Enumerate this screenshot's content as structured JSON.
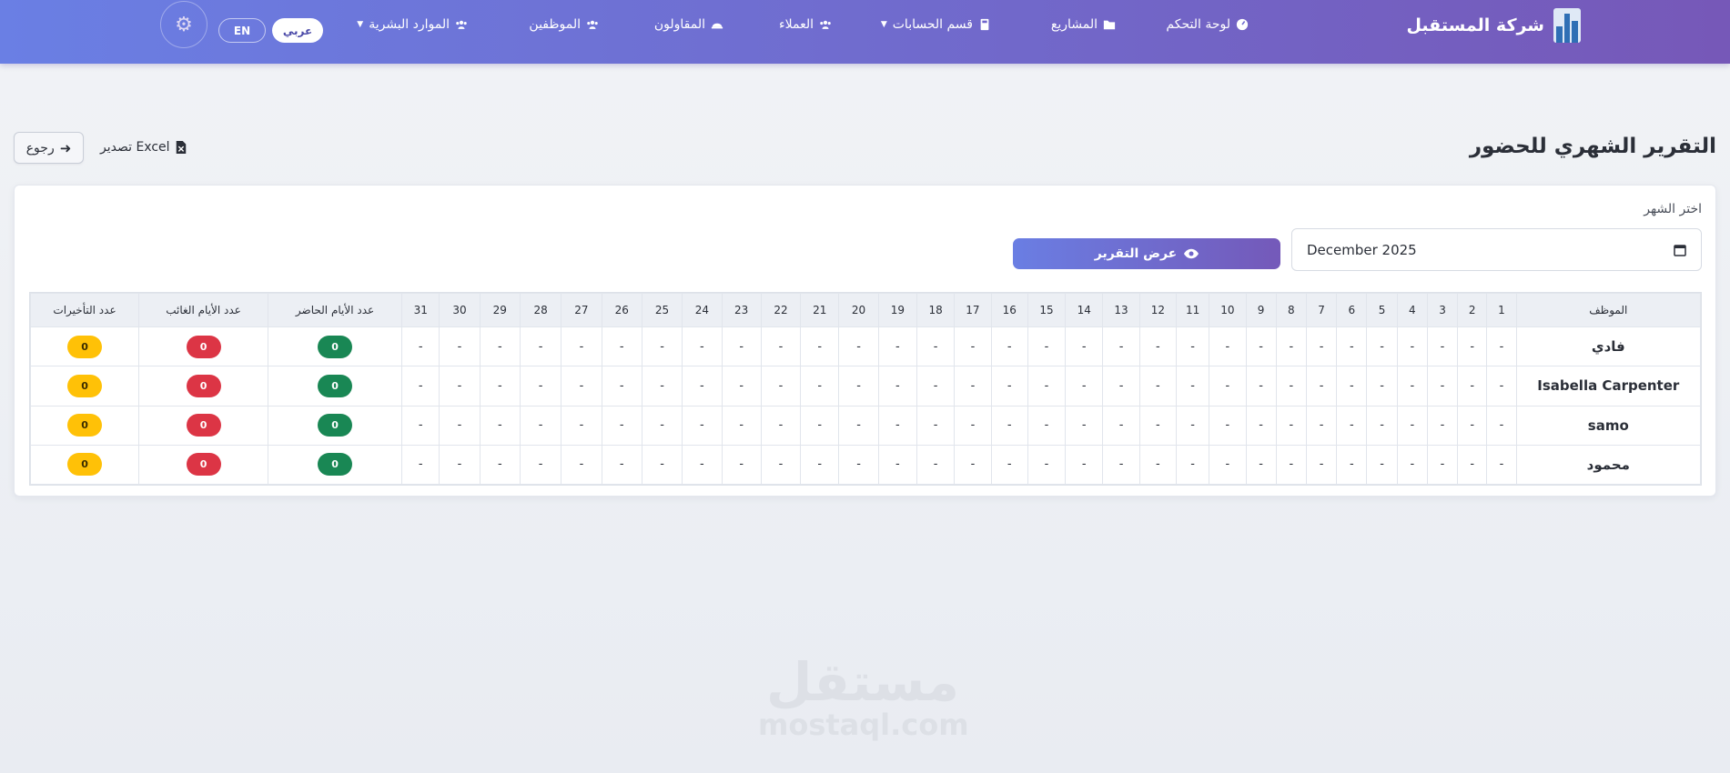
{
  "brand": {
    "name": "شركة المستقبل"
  },
  "nav": {
    "dashboard": "لوحة التحكم",
    "projects": "المشاريع",
    "accounts": "قسم الحسابات",
    "clients": "العملاء",
    "contractors": "المقاولون",
    "employees": "الموظفين",
    "hr": "الموارد البشرية",
    "lang_ar": "عربي",
    "lang_en": "EN"
  },
  "header": {
    "title": "التقرير الشهري للحضور",
    "export_label": "تصدير Excel",
    "back_label": "رجوع"
  },
  "filter": {
    "month_label": "اختر الشهر",
    "month_value": "December 2025",
    "show_button": "عرض التقرير"
  },
  "table": {
    "employee_header": "الموظف",
    "days": [
      "1",
      "2",
      "3",
      "4",
      "5",
      "6",
      "7",
      "8",
      "9",
      "10",
      "11",
      "12",
      "13",
      "14",
      "15",
      "16",
      "17",
      "18",
      "19",
      "20",
      "21",
      "22",
      "23",
      "24",
      "25",
      "26",
      "27",
      "28",
      "29",
      "30",
      "31"
    ],
    "present_header": "عدد الأيام الحاضر",
    "absent_header": "عدد الأيام الغائب",
    "late_header": "عدد التأخيرات",
    "empty_cell": "-",
    "rows": [
      {
        "name": "فادي",
        "present": "0",
        "absent": "0",
        "late": "0"
      },
      {
        "name": "Isabella Carpenter",
        "present": "0",
        "absent": "0",
        "late": "0"
      },
      {
        "name": "samo",
        "present": "0",
        "absent": "0",
        "late": "0"
      },
      {
        "name": "محمود",
        "present": "0",
        "absent": "0",
        "late": "0"
      }
    ]
  },
  "watermark": {
    "arabic": "مستقل",
    "latin": "mostaql.com"
  },
  "colors": {
    "nav_start": "#6a7fe4",
    "nav_end": "#7658b8",
    "present": "#198754",
    "absent": "#dc3545",
    "late": "#ffc107"
  }
}
